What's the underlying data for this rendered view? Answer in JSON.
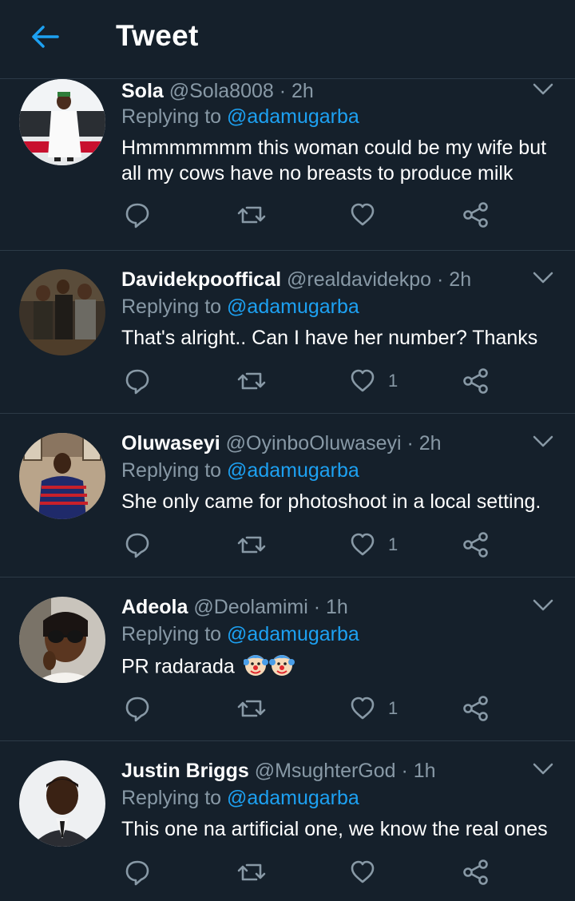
{
  "header": {
    "title": "Tweet"
  },
  "colors": {
    "background": "#15202b",
    "accent": "#1da1f2",
    "muted": "#8899a6",
    "divider": "#2c3a47"
  },
  "tweets": [
    {
      "name": "Sola",
      "handle": "@Sola8008",
      "time": "2h",
      "reply_prefix": "Replying to",
      "reply_to": "@adamugarba",
      "text": "Hmmmmmmm this woman could be my wife but all my cows have no breasts to produce milk",
      "like_count": ""
    },
    {
      "name": "Davidekpooffical",
      "handle": "@realdavidekpo",
      "time": "2h",
      "reply_prefix": "Replying to",
      "reply_to": "@adamugarba",
      "text": "That's alright.. Can I have her number? Thanks",
      "like_count": "1"
    },
    {
      "name": "Oluwaseyi",
      "handle": "@OyinboOluwaseyi",
      "time": "2h",
      "reply_prefix": "Replying to",
      "reply_to": "@adamugarba",
      "text": "She only came for photoshoot in a local setting.",
      "like_count": "1"
    },
    {
      "name": "Adeola",
      "handle": "@Deolamimi",
      "time": "1h",
      "reply_prefix": "Replying to",
      "reply_to": "@adamugarba",
      "text": "PR radarada",
      "like_count": "1"
    },
    {
      "name": "Justin Briggs",
      "handle": "@MsughterGod",
      "time": "1h",
      "reply_prefix": "Replying to",
      "reply_to": "@adamugarba",
      "text": "This one na artificial one, we know the real ones",
      "like_count": ""
    }
  ],
  "separator": "·",
  "icons": {
    "back": "arrow-left-icon",
    "more": "chevron-down-icon",
    "reply": "reply-bubble-icon",
    "retweet": "retweet-icon",
    "like": "heart-icon",
    "share": "share-icon",
    "emoji": "clown-face-emoji"
  }
}
